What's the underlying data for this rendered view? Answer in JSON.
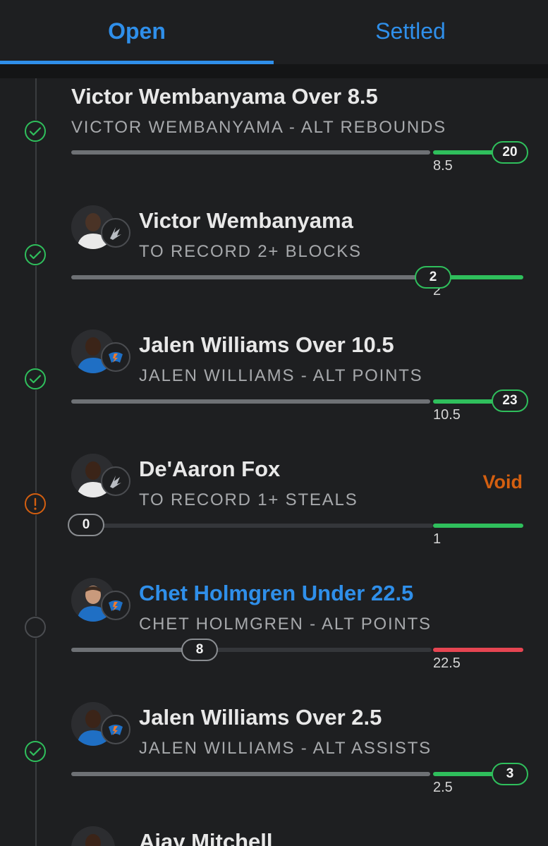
{
  "tabs": {
    "open": "Open",
    "settled": "Settled"
  },
  "colors": {
    "accent": "#2f8fea",
    "win": "#2fbf5c",
    "loss": "#e64552",
    "void": "#d45f10"
  },
  "legs": [
    {
      "title": "Victor Wembanyama Over 8.5",
      "subtitle": "VICTOR WEMBANYAMA - ALT REBOUNDS",
      "status_icon": "check-circle-icon",
      "has_avatar": false,
      "threshold": "8.5",
      "current": "20"
    },
    {
      "title": "Victor Wembanyama",
      "subtitle": "TO RECORD 2+ BLOCKS",
      "status_icon": "check-circle-icon",
      "team_icon": "spurs-logo-icon",
      "threshold": "2",
      "current": "2"
    },
    {
      "title": "Jalen Williams Over 10.5",
      "subtitle": "JALEN WILLIAMS - ALT POINTS",
      "status_icon": "check-circle-icon",
      "team_icon": "thunder-logo-icon",
      "threshold": "10.5",
      "current": "23"
    },
    {
      "title": "De'Aaron Fox",
      "subtitle": "TO RECORD 1+ STEALS",
      "status_icon": "alert-circle-icon",
      "team_icon": "spurs-logo-icon",
      "status_label": "Void",
      "threshold": "1",
      "current": "0"
    },
    {
      "title": "Chet Holmgren Under 22.5",
      "subtitle": "CHET HOLMGREN - ALT POINTS",
      "status_icon": "pending-circle-icon",
      "team_icon": "thunder-logo-icon",
      "threshold": "22.5",
      "current": "8"
    },
    {
      "title": "Jalen Williams Over 2.5",
      "subtitle": "JALEN WILLIAMS - ALT ASSISTS",
      "status_icon": "check-circle-icon",
      "team_icon": "thunder-logo-icon",
      "threshold": "2.5",
      "current": "3"
    },
    {
      "title": "Ajay Mitchell"
    }
  ]
}
